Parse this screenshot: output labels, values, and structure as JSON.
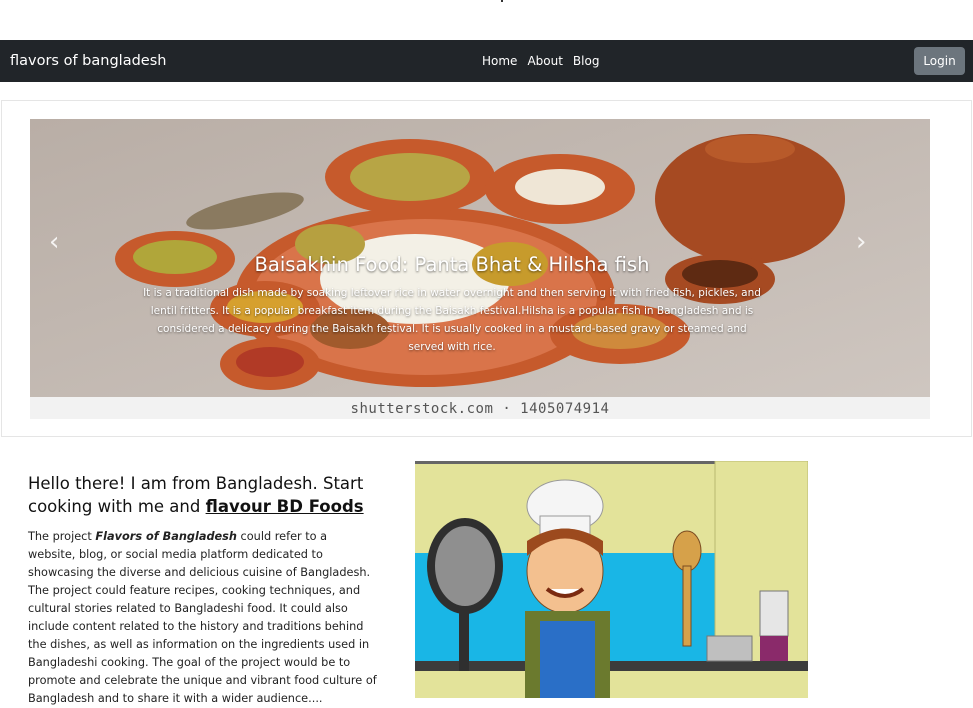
{
  "navbar": {
    "brand": "flavors of bangladesh",
    "links": [
      "Home",
      "About",
      "Blog"
    ],
    "login_label": "Login"
  },
  "carousel": {
    "title": "Baisakhin Food: Panta Bhat & Hilsha fish",
    "description": "It is a traditional dish made by soaking leftover rice in water overnight and then serving it with fried fish, pickles, and lentil fritters. It is a popular breakfast item during the Baisakh festival.Hilsha is a popular fish in Bangladesh and is considered a delicacy during the Baisakh festival. It is usually cooked in a mustard-based gravy or steamed and served with rice.",
    "watermark": "shutterstock.com · 1405074914",
    "prev_icon": "chevron-left-icon",
    "next_icon": "chevron-right-icon"
  },
  "intro": {
    "heading_text": "Hello there! I am from Bangladesh. Start cooking with me and ",
    "heading_link": "flavour BD Foods",
    "paragraph_lead": "The project ",
    "paragraph_emph": "Flavors of Bangladesh",
    "paragraph_rest": " could refer to a website, blog, or social media platform dedicated to showcasing the diverse and delicious cuisine of Bangladesh. The project could feature recipes, cooking techniques, and cultural stories related to Bangladeshi food. It could also include content related to the history and traditions behind the dishes, as well as information on the ingredients used in Bangladeshi cooking. The goal of the project would be to promote and celebrate the unique and vibrant food culture of Bangladesh and to share it with a wider audience...."
  },
  "colors": {
    "navbar_bg": "#212529",
    "login_bg": "#6c757d",
    "kitchen_blue": "#19b6e6",
    "cabinet_yellow": "#e3e39a"
  }
}
